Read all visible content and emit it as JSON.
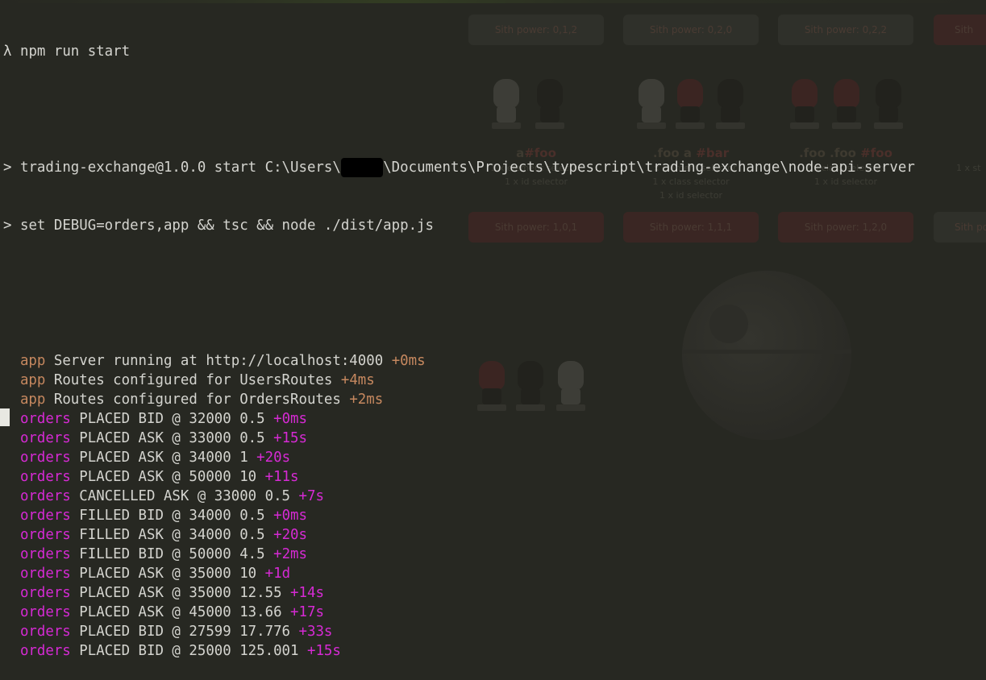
{
  "terminal": {
    "command_line": {
      "prompt": "λ",
      "command": "npm run start"
    },
    "script_lines": [
      {
        "prompt": ">",
        "before": "trading-exchange@1.0.0 start C:\\Users\\",
        "redacted": "█████",
        "after": "\\Documents\\Projects\\typescript\\trading-exchange\\node-api-server"
      },
      {
        "prompt": ">",
        "before": "set DEBUG=orders,app && tsc && node ./dist/app.js",
        "redacted": "",
        "after": ""
      }
    ],
    "log_lines": [
      {
        "ns": "app",
        "msg": "Server running at http://localhost:4000",
        "delta": "+0ms"
      },
      {
        "ns": "app",
        "msg": "Routes configured for UsersRoutes",
        "delta": "+4ms"
      },
      {
        "ns": "app",
        "msg": "Routes configured for OrdersRoutes",
        "delta": "+2ms"
      },
      {
        "ns": "orders",
        "msg": "PLACED BID @ 32000 0.5",
        "delta": "+0ms"
      },
      {
        "ns": "orders",
        "msg": "PLACED ASK @ 33000 0.5",
        "delta": "+15s"
      },
      {
        "ns": "orders",
        "msg": "PLACED ASK @ 34000 1",
        "delta": "+20s"
      },
      {
        "ns": "orders",
        "msg": "PLACED ASK @ 50000 10",
        "delta": "+11s"
      },
      {
        "ns": "orders",
        "msg": "CANCELLED ASK @ 33000 0.5",
        "delta": "+7s"
      },
      {
        "ns": "orders",
        "msg": "FILLED BID @ 34000 0.5",
        "delta": "+0ms"
      },
      {
        "ns": "orders",
        "msg": "FILLED ASK @ 34000 0.5",
        "delta": "+20s"
      },
      {
        "ns": "orders",
        "msg": "FILLED BID @ 50000 4.5",
        "delta": "+2ms"
      },
      {
        "ns": "orders",
        "msg": "PLACED ASK @ 35000 10",
        "delta": "+1d"
      },
      {
        "ns": "orders",
        "msg": "PLACED ASK @ 35000 12.55",
        "delta": "+14s"
      },
      {
        "ns": "orders",
        "msg": "PLACED ASK @ 45000 13.66",
        "delta": "+17s"
      },
      {
        "ns": "orders",
        "msg": "PLACED BID @ 27599 17.776",
        "delta": "+33s"
      },
      {
        "ns": "orders",
        "msg": "PLACED BID @ 25000 125.001",
        "delta": "+15s"
      }
    ]
  },
  "background_page": {
    "top_buttons": [
      "Sith power: 0,1,2",
      "Sith power: 0,2,0",
      "Sith power: 0,2,2",
      "Sith"
    ],
    "cards": [
      {
        "selector_plain": "a",
        "selector_accent": "#foo",
        "lines": [
          "1 x element selector",
          "1 x id selector"
        ],
        "button": "Sith power: 1,0,1"
      },
      {
        "selector_plain": ".foo a",
        "selector_accent": "#bar",
        "lines": [
          "1 x element selector",
          "1 x class selector",
          "1 x id selector"
        ],
        "button": "Sith power: 1,1,1"
      },
      {
        "selector_plain": ".foo .foo",
        "selector_accent": "#foo",
        "lines": [
          "2 x class selectors",
          "1 x id selector"
        ],
        "button": "Sith power: 1,2,0"
      }
    ],
    "partial_right": {
      "line": "1 x st",
      "button": "Sith pov"
    }
  },
  "colors": {
    "terminal_bg": "#272822",
    "text": "#d4d4cf",
    "app_namespace": "#c6885f",
    "orders_namespace": "#d62ad4"
  }
}
